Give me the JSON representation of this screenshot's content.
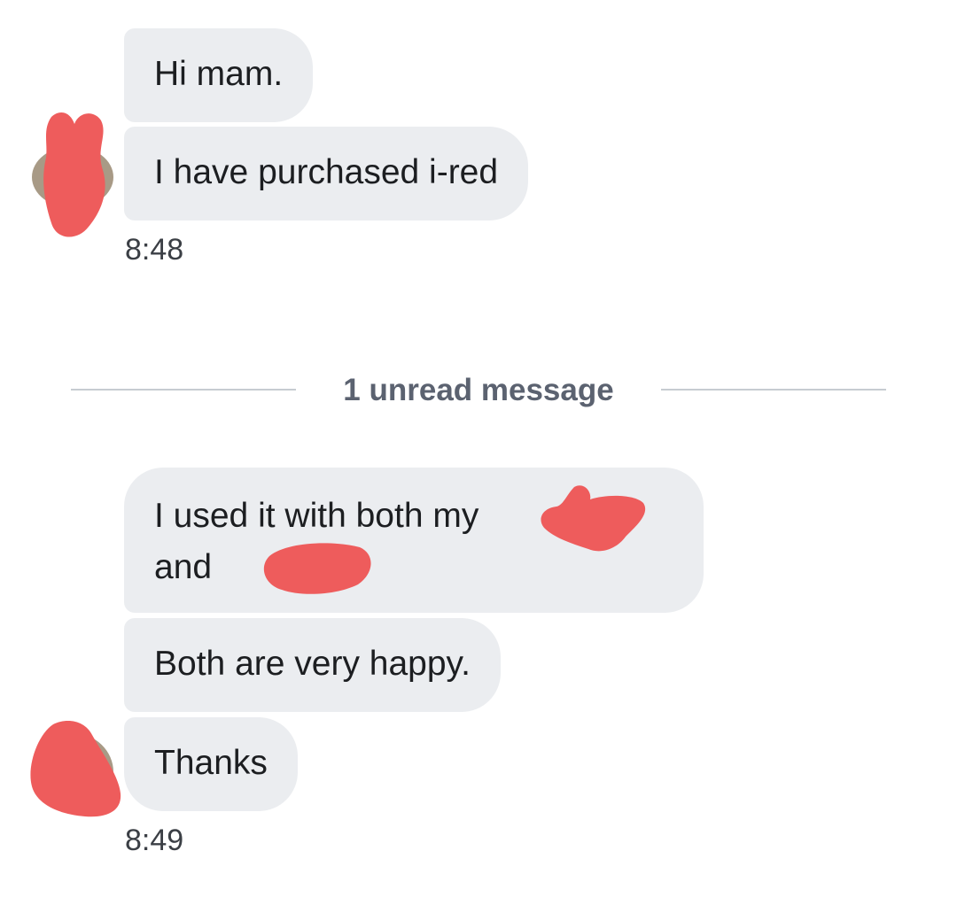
{
  "thread": {
    "group1": {
      "messages": [
        {
          "text": "Hi mam."
        },
        {
          "text": "I have purchased i-red"
        }
      ],
      "timestamp": "8:48",
      "avatar_icon": "redacted-avatar-icon"
    },
    "divider": {
      "label": "1 unread message"
    },
    "group2": {
      "messages": [
        {
          "line1": "I used it with both my",
          "line2": "and"
        },
        {
          "text": "Both are very happy."
        },
        {
          "text": "Thanks"
        }
      ],
      "timestamp": "8:49",
      "avatar_icon": "redacted-avatar-icon"
    }
  },
  "colors": {
    "bubble": "#ebedf0",
    "redaction": "#ee5c5c",
    "divider_text": "#5b6270"
  }
}
